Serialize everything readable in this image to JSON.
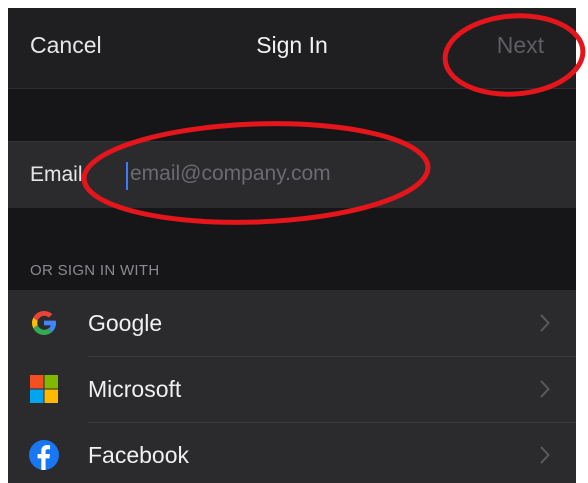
{
  "navbar": {
    "cancel_label": "Cancel",
    "title": "Sign In",
    "next_label": "Next"
  },
  "email": {
    "label": "Email",
    "value": "",
    "placeholder": "email@company.com"
  },
  "section": {
    "header": "OR SIGN IN WITH"
  },
  "providers": [
    {
      "label": "Google",
      "icon": "google-icon"
    },
    {
      "label": "Microsoft",
      "icon": "microsoft-icon"
    },
    {
      "label": "Facebook",
      "icon": "facebook-icon"
    }
  ],
  "colors": {
    "background": "#1c1c1e",
    "row": "#2b2b2e",
    "caret": "#3d7bfd",
    "annotation": "#e4151b",
    "next_disabled": "#5e5e63"
  }
}
